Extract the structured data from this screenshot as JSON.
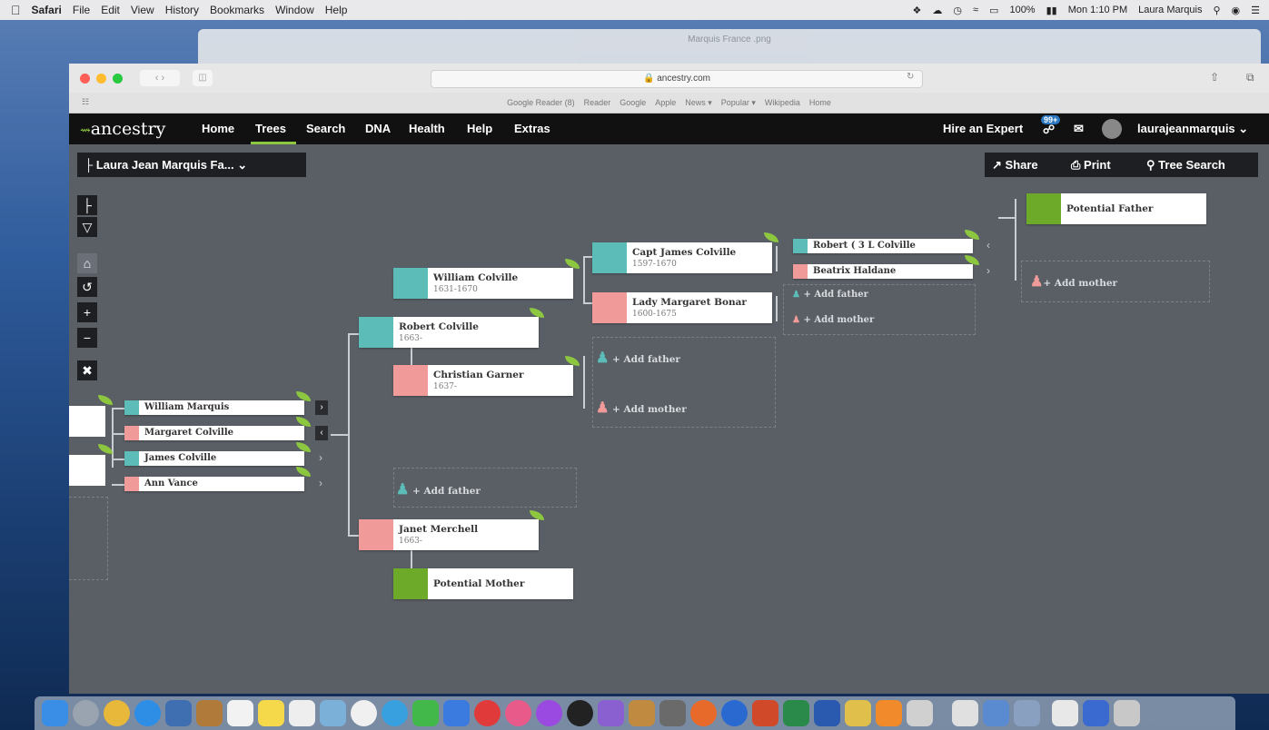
{
  "menubar": {
    "app": "Safari",
    "items": [
      "File",
      "Edit",
      "View",
      "History",
      "Bookmarks",
      "Window",
      "Help"
    ],
    "battery": "100%",
    "clock": "Mon 1:10 PM",
    "user": "Laura Marquis"
  },
  "bg_window_title": "Marquis France .png",
  "browser": {
    "url": "ancestry.com",
    "bookmarks": [
      "Google Reader (8)",
      "Reader",
      "Google",
      "Apple",
      "News ▾",
      "Popular ▾",
      "Wikipedia",
      "Home"
    ]
  },
  "site": {
    "logo": "ancestry",
    "nav": [
      "Home",
      "Trees",
      "Search",
      "DNA",
      "Health",
      "Help",
      "Extras"
    ],
    "hire": "Hire an Expert",
    "badge": "99+",
    "username": "laurajeanmarquis"
  },
  "tree": {
    "title": "Laura Jean Marquis Fa...",
    "share": "Share",
    "print": "Print",
    "tree_search": "Tree Search",
    "add_father": "+ Add father",
    "add_mother": "+ Add mother",
    "people": {
      "william_marquis": {
        "name": "William Marquis"
      },
      "margaret_colville": {
        "name": "Margaret Colville"
      },
      "james_colville": {
        "name": "James Colville"
      },
      "ann_vance": {
        "name": "Ann Vance"
      },
      "robert_colville": {
        "name": "Robert Colville",
        "dates": "1663-"
      },
      "janet_merchell": {
        "name": "Janet Merchell",
        "dates": "1663-"
      },
      "potential_mother": {
        "name": "Potential Mother"
      },
      "william_colville": {
        "name": "William Colville",
        "dates": "1631-1670"
      },
      "christian_garner": {
        "name": "Christian Garner",
        "dates": "1637-"
      },
      "capt_james": {
        "name": "Capt James Colville",
        "dates": "1597-1670"
      },
      "lady_margaret": {
        "name": "Lady Margaret Bonar",
        "dates": "1600-1675"
      },
      "robert_3l": {
        "name": "Robert ( 3 L Colville"
      },
      "beatrix": {
        "name": "Beatrix Haldane"
      },
      "potential_father": {
        "name": "Potential Father"
      }
    }
  },
  "colors": {
    "male": "#5cbdb8",
    "female": "#f09a99",
    "potential": "#6eaa2a",
    "leaf": "#8dc63f",
    "canvas": "#5a5f66"
  }
}
